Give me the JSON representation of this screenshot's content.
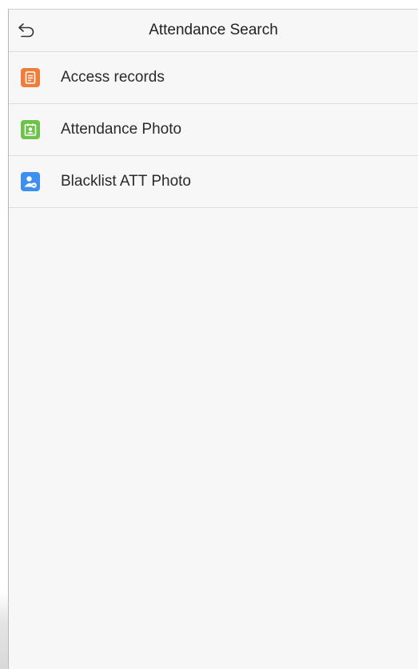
{
  "header": {
    "title": "Attendance Search",
    "back_icon": "back-arrow-icon"
  },
  "menu": {
    "items": [
      {
        "label": "Access records",
        "icon": "document-icon",
        "color": "#f07d3a"
      },
      {
        "label": "Attendance Photo",
        "icon": "photo-id-icon",
        "color": "#6cc24a"
      },
      {
        "label": "Blacklist ATT Photo",
        "icon": "user-blocked-icon",
        "color": "#3f8ff0"
      }
    ]
  }
}
